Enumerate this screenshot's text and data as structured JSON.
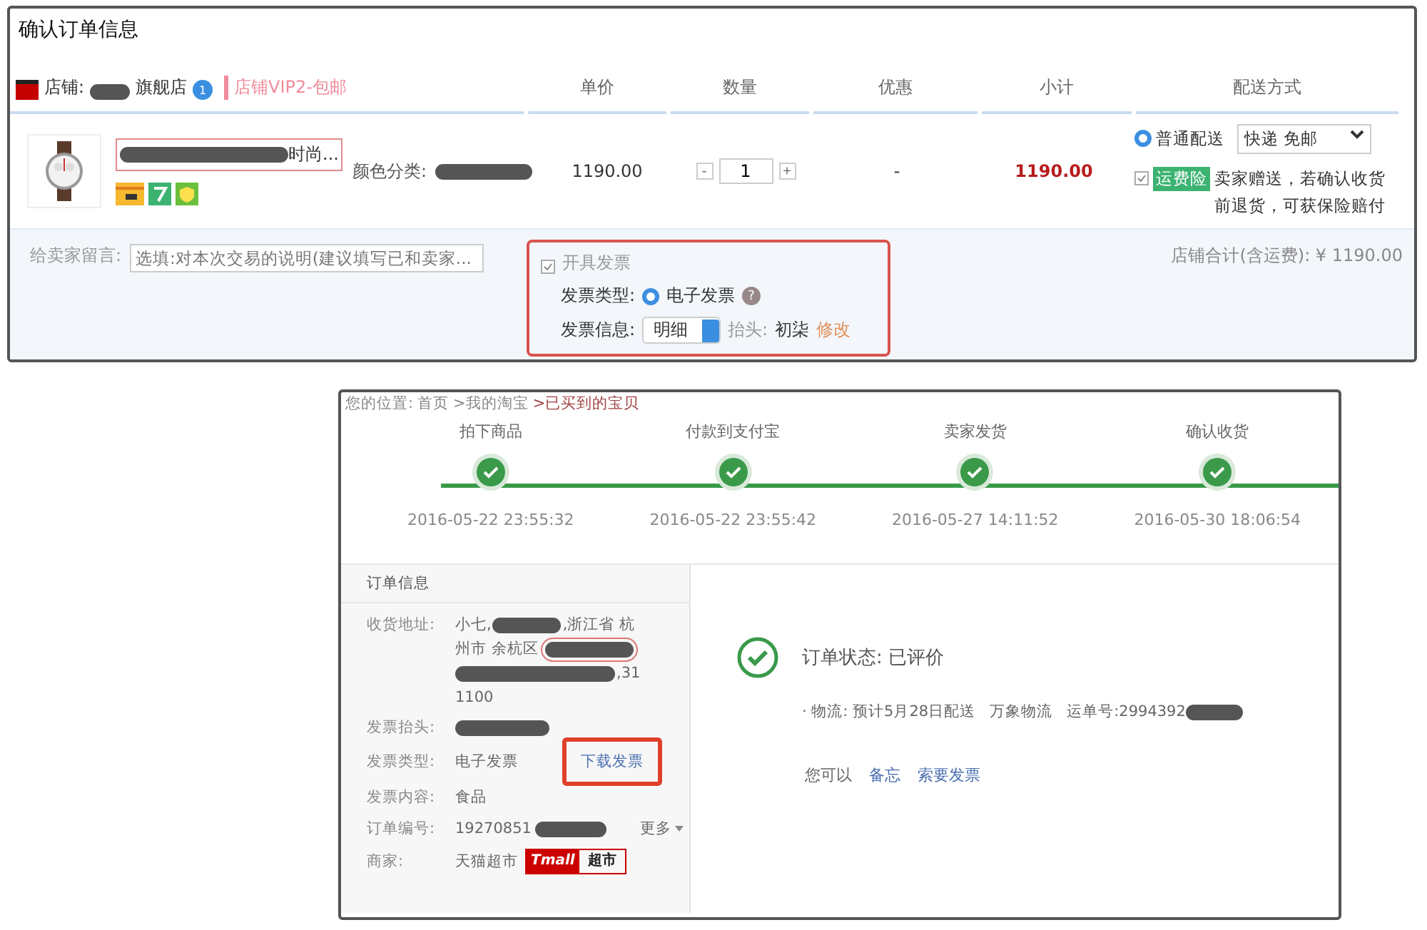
{
  "order_confirm": {
    "title": "确认订单信息",
    "shop": {
      "label": "店铺:",
      "name_suffix": "旗舰店",
      "badge": "1",
      "promo": "店铺VIP2-包邮"
    },
    "columns": [
      "单价",
      "数量",
      "优惠",
      "小计",
      "配送方式"
    ],
    "item": {
      "title_suffix": "时尚...",
      "title_highlighted": true,
      "spec_label": "颜色分类:",
      "price": "1190.00",
      "minus": "-",
      "quantity": "1",
      "plus": "+",
      "discount": "-",
      "subtotal": "1190.00",
      "shipping": {
        "option": "普通配送",
        "selected": true,
        "method": "快递 免邮"
      },
      "insurance": {
        "checked": true,
        "badge": "运费险",
        "text": "卖家赠送，若确认收货前退货，可获保险赔付"
      }
    },
    "message": {
      "label": "给卖家留言:",
      "placeholder": "选填:对本次交易的说明(建议填写已和卖家..."
    },
    "invoice": {
      "highlighted": true,
      "checked": true,
      "label": "开具发票",
      "type_label": "发票类型:",
      "type_option": "电子发票",
      "type_selected": true,
      "help": "?",
      "info_label": "发票信息:",
      "info_value": "明细",
      "header_label": "抬头:",
      "header_value": "初柒",
      "edit_link": "修改"
    },
    "total": "店铺合计(含运费): ¥ 1190.00"
  },
  "order_detail": {
    "breadcrumb": [
      {
        "text": "您的位置:",
        "kind": "label"
      },
      {
        "text": "首页",
        "kind": "link"
      },
      {
        "text": ">我的淘宝",
        "kind": "link"
      },
      {
        "text": ">已买到的宝贝",
        "kind": "current"
      }
    ],
    "steps": [
      {
        "label": "拍下商品",
        "time": "2016-05-22 23:55:32",
        "done": true
      },
      {
        "label": "付款到支付宝",
        "time": "2016-05-22 23:55:42",
        "done": true
      },
      {
        "label": "卖家发货",
        "time": "2016-05-27 14:11:52",
        "done": true
      },
      {
        "label": "确认收货",
        "time": "2016-05-30 18:06:54",
        "done": true
      }
    ],
    "info_title": "订单信息",
    "address": {
      "label": "收货地址:",
      "lines": [
        [
          {
            "kind": "text",
            "text": "小七,"
          },
          {
            "kind": "redacted"
          },
          {
            "kind": "text",
            "text": ",浙江省 杭"
          }
        ],
        [
          {
            "kind": "text",
            "text": "州市 余杭区"
          },
          {
            "kind": "redacted",
            "highlighted": true
          }
        ],
        [
          {
            "kind": "redacted"
          },
          {
            "kind": "text",
            "text": ",31"
          }
        ],
        [
          {
            "kind": "text",
            "text": "1100"
          }
        ]
      ]
    },
    "fields": [
      {
        "label": "发票抬头:",
        "kind": "redacted"
      },
      {
        "label": "发票类型:",
        "kind": "text",
        "value": "电子发票",
        "link": "下载发票",
        "link_highlighted": true
      },
      {
        "label": "发票内容:",
        "kind": "text",
        "value": "食品"
      },
      {
        "label": "订单编号:",
        "kind": "partial",
        "value": "19270851",
        "more": "更多"
      },
      {
        "label": "商家:",
        "kind": "seller",
        "value": "天猫超市",
        "logo_left": "Tmall",
        "logo_right": "超市"
      }
    ],
    "status": "订单状态: 已评价",
    "logistics": "· 物流: 预计5月28日配送   万象物流   运单号:2994392",
    "actions_label": "您可以",
    "actions": [
      "备忘",
      "索要发票"
    ]
  }
}
